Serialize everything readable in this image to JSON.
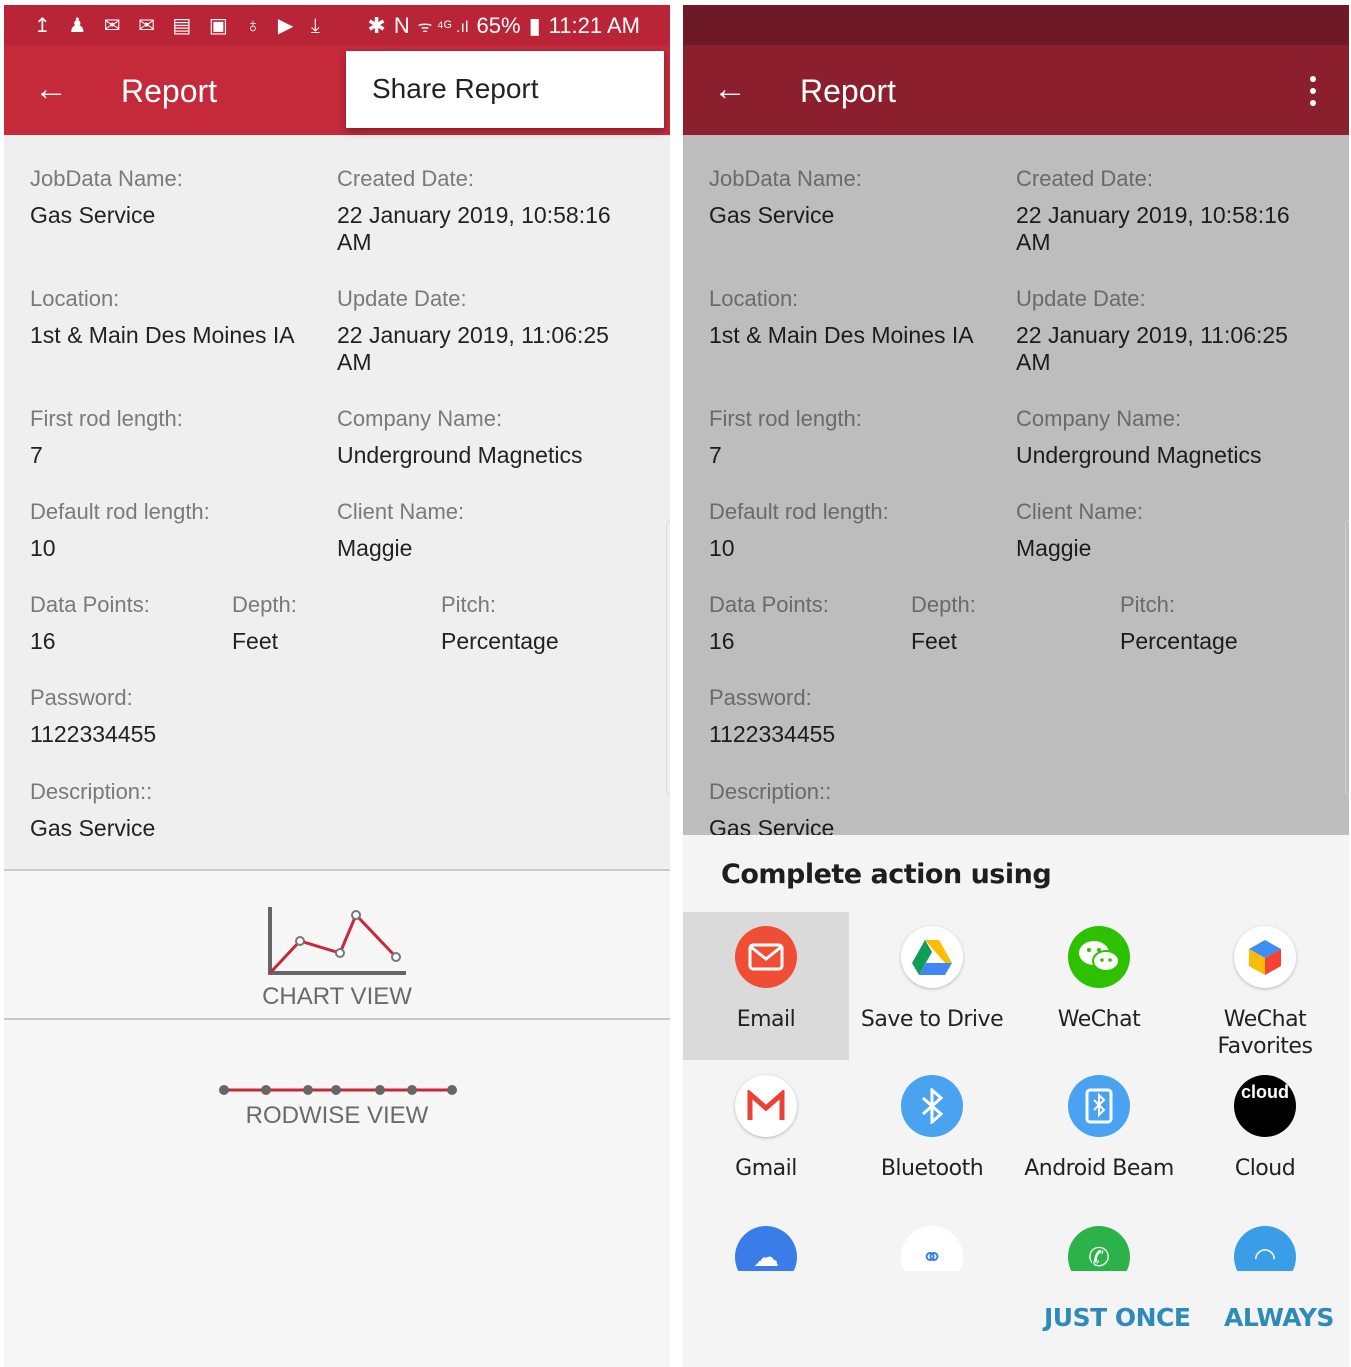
{
  "status_bar": {
    "left_icons": "↥ ♟ ✉ ✉ ▤ ▣ ♁ ▶ ⤓",
    "bluetooth": "✱",
    "nfc": "N",
    "signal": "ᯤ ⁴ᴳ .ıl",
    "battery_pct": "65%",
    "battery_icon": "▮",
    "time": "11:21 AM"
  },
  "left": {
    "appbar": {
      "back_icon": "←",
      "title": "Report"
    },
    "popup": {
      "label": "Share Report"
    },
    "chart_view_label": "CHART VIEW",
    "rodwise_view_label": "RODWISE VIEW"
  },
  "right": {
    "appbar": {
      "back_icon": "←",
      "title": "Report"
    },
    "sheet": {
      "heading": "Complete action using",
      "apps": [
        {
          "name": "Email",
          "icon": "envelope-icon",
          "color": "#ef4d35",
          "glyph": "✉"
        },
        {
          "name": "Save to Drive",
          "icon": "drive-icon",
          "color": "#ffffff",
          "glyph": "▲"
        },
        {
          "name": "WeChat",
          "icon": "wechat-icon",
          "color": "#2dc100",
          "glyph": "💬"
        },
        {
          "name": "WeChat Favorites",
          "icon": "cube-icon",
          "color": "#ffffff",
          "glyph": "◆"
        },
        {
          "name": "Gmail",
          "icon": "gmail-icon",
          "color": "#ffffff",
          "glyph": "M"
        },
        {
          "name": "Bluetooth",
          "icon": "bluetooth-icon",
          "color": "#4aa3f0",
          "glyph": "✱"
        },
        {
          "name": "Android Beam",
          "icon": "android-beam-icon",
          "color": "#4aa3f0",
          "glyph": "▯"
        },
        {
          "name": "Cloud",
          "icon": "cloud-icon",
          "color": "#000000",
          "glyph": "cloud"
        }
      ],
      "just_once": "JUST ONCE",
      "always": "ALWAYS"
    }
  },
  "report": {
    "jobdata_name_label": "JobData Name:",
    "jobdata_name": "Gas Service",
    "created_date_label": "Created Date:",
    "created_date_line1": "22 January 2019, 10:58:16",
    "created_date_line2": "AM",
    "location_label": "Location:",
    "location": "1st & Main Des Moines IA",
    "update_date_label": "Update Date:",
    "update_date_line1": "22 January 2019, 11:06:25",
    "update_date_line2": "AM",
    "first_rod_label": "First rod length:",
    "first_rod": "7",
    "company_label": "Company Name:",
    "company": "Underground Magnetics",
    "default_rod_label": "Default rod length:",
    "default_rod": "10",
    "client_label": "Client Name:",
    "client": "Maggie",
    "data_points_label": "Data Points:",
    "data_points": "16",
    "depth_label": "Depth:",
    "depth": "Feet",
    "pitch_label": "Pitch:",
    "pitch": "Percentage",
    "password_label": "Password:",
    "password": "1122334455",
    "description_label": "Description::",
    "description": "Gas Service"
  },
  "colors": {
    "primary": "#c52a3b",
    "primary_dark": "#b92536",
    "dimmed_primary": "#8c1f2d",
    "accent": "#2e8bb8"
  }
}
